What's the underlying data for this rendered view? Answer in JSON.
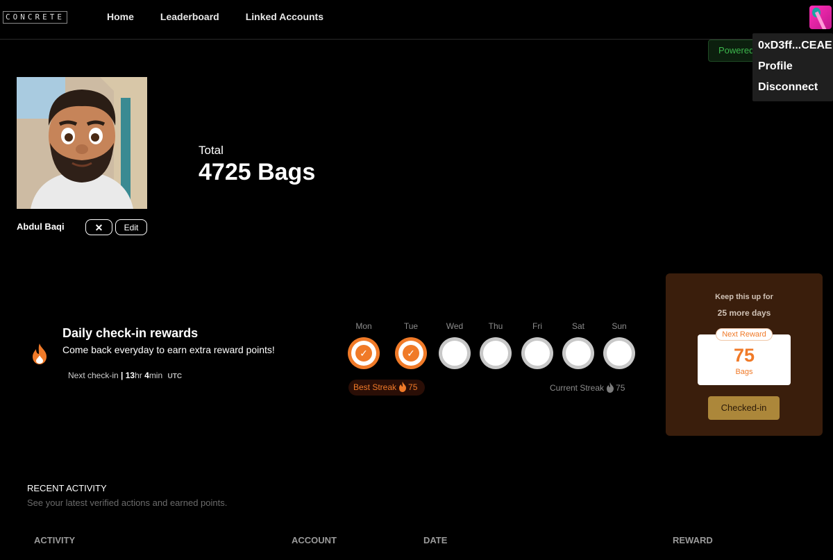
{
  "header": {
    "logo": "CONCRETE",
    "nav": [
      "Home",
      "Leaderboard",
      "Linked Accounts"
    ],
    "powered_text": "Powered"
  },
  "account_menu": {
    "address": "0xD3ff...CEAE",
    "items": [
      "Profile",
      "Disconnect"
    ]
  },
  "profile": {
    "name": "Abdul Baqi",
    "clear_label": "✕",
    "edit_label": "Edit",
    "total_label": "Total",
    "total_value": "4725 Bags"
  },
  "checkin": {
    "title": "Daily check-in rewards",
    "subtitle": "Come back everyday to earn extra reward points!",
    "next_label": "Next check-in",
    "separator": "|",
    "hours": "13",
    "hours_unit": "hr",
    "minutes": "4",
    "minutes_unit": "min",
    "timezone": "UTC",
    "days": [
      {
        "label": "Mon",
        "checked": true
      },
      {
        "label": "Tue",
        "checked": true
      },
      {
        "label": "Wed",
        "checked": false
      },
      {
        "label": "Thu",
        "checked": false
      },
      {
        "label": "Fri",
        "checked": false
      },
      {
        "label": "Sat",
        "checked": false
      },
      {
        "label": "Sun",
        "checked": false
      }
    ],
    "best_streak_label": "Best Streak",
    "best_streak_value": "75",
    "current_streak_label": "Current Streak",
    "current_streak_value": "75"
  },
  "reward_card": {
    "keep_text": "Keep this up for",
    "days_text": "25 more days",
    "tag": "Next Reward",
    "value": "75",
    "unit": "Bags",
    "button": "Checked-in"
  },
  "activity": {
    "title": "RECENT ACTIVITY",
    "subtitle": "See your latest verified actions and earned points.",
    "columns": [
      "ACTIVITY",
      "ACCOUNT",
      "DATE",
      "REWARD"
    ]
  },
  "colors": {
    "accent_orange": "#f07a28",
    "reward_bg": "#3a1e0c",
    "button_gold": "#ac873a"
  }
}
